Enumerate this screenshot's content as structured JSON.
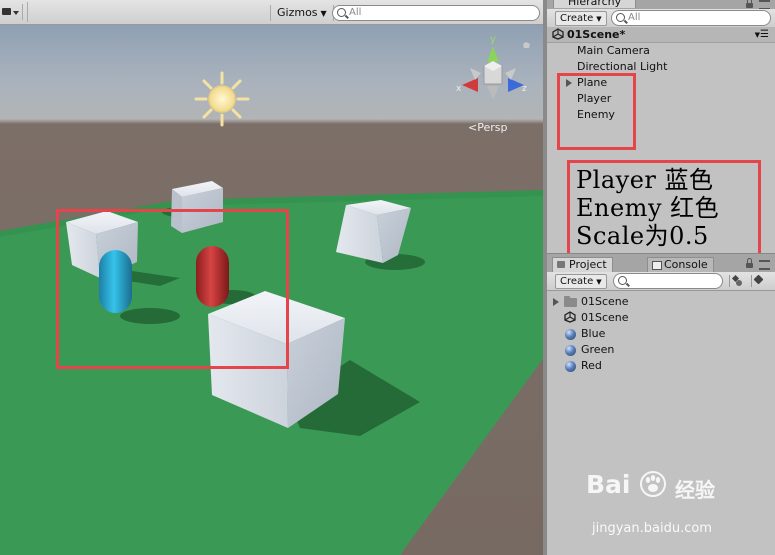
{
  "scene_view": {
    "gizmos_label": "Gizmos",
    "search_placeholder": "All",
    "projection_label": "Persp",
    "axis_labels": {
      "y": "y",
      "x": "x",
      "z": "z"
    }
  },
  "hierarchy": {
    "tab_label": "Hierarchy",
    "create_label": "Create",
    "search_placeholder": "All",
    "scene_name": "01Scene*",
    "items": [
      "Main Camera",
      "Directional Light",
      "Plane",
      "Player",
      "Enemy"
    ]
  },
  "annotation": {
    "line1": "Player 蓝色",
    "line2": "Enemy 红色",
    "line3": "Scale为0.5"
  },
  "project": {
    "tabs": [
      "Project",
      "Console"
    ],
    "create_label": "Create",
    "items": [
      "01Scene",
      "01Scene",
      "Blue",
      "Green",
      "Red"
    ]
  },
  "watermark": {
    "logo_left": "Bai",
    "logo_right": "经验",
    "url": "jingyan.baidu.com"
  },
  "colors": {
    "highlight_box": "#e5444a",
    "ground": "#3a9a55",
    "player": "#2bb3d8",
    "enemy": "#c43232"
  }
}
